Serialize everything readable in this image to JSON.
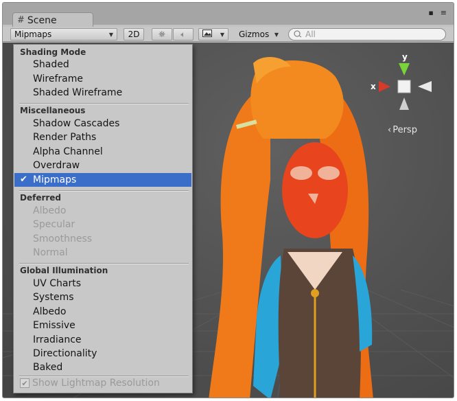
{
  "tab": {
    "title": "Scene"
  },
  "toolbar": {
    "render_mode": "Mipmaps",
    "two_d": "2D",
    "gizmos": "Gizmos",
    "search_placeholder": "All"
  },
  "gizmo": {
    "x_label": "x",
    "y_label": "y",
    "projection": "Persp"
  },
  "menu": {
    "sections": [
      {
        "title": "Shading Mode",
        "items": [
          {
            "label": "Shaded",
            "enabled": true
          },
          {
            "label": "Wireframe",
            "enabled": true
          },
          {
            "label": "Shaded Wireframe",
            "enabled": true
          }
        ]
      },
      {
        "title": "Miscellaneous",
        "items": [
          {
            "label": "Shadow Cascades",
            "enabled": true
          },
          {
            "label": "Render Paths",
            "enabled": true
          },
          {
            "label": "Alpha Channel",
            "enabled": true
          },
          {
            "label": "Overdraw",
            "enabled": true
          },
          {
            "label": "Mipmaps",
            "enabled": true,
            "selected": true
          }
        ]
      },
      {
        "title": "Deferred",
        "items": [
          {
            "label": "Albedo",
            "enabled": false
          },
          {
            "label": "Specular",
            "enabled": false
          },
          {
            "label": "Smoothness",
            "enabled": false
          },
          {
            "label": "Normal",
            "enabled": false
          }
        ]
      },
      {
        "title": "Global Illumination",
        "items": [
          {
            "label": "UV Charts",
            "enabled": true
          },
          {
            "label": "Systems",
            "enabled": true
          },
          {
            "label": "Albedo",
            "enabled": true
          },
          {
            "label": "Emissive",
            "enabled": true
          },
          {
            "label": "Irradiance",
            "enabled": true
          },
          {
            "label": "Directionality",
            "enabled": true
          },
          {
            "label": "Baked",
            "enabled": true
          }
        ]
      }
    ],
    "footer": {
      "label": "Show Lightmap Resolution",
      "checked": true,
      "enabled": false
    }
  },
  "colors": {
    "selection": "#3b6ec9",
    "gizmo_x": "#d83a2a",
    "gizmo_y": "#7bd33a",
    "viewport_bg": "#4e4e4e"
  },
  "icons": [
    "scene-tab-icon",
    "lighting-toggle-icon",
    "audio-toggle-icon",
    "effects-icon",
    "search-icon",
    "checkmark-icon"
  ]
}
